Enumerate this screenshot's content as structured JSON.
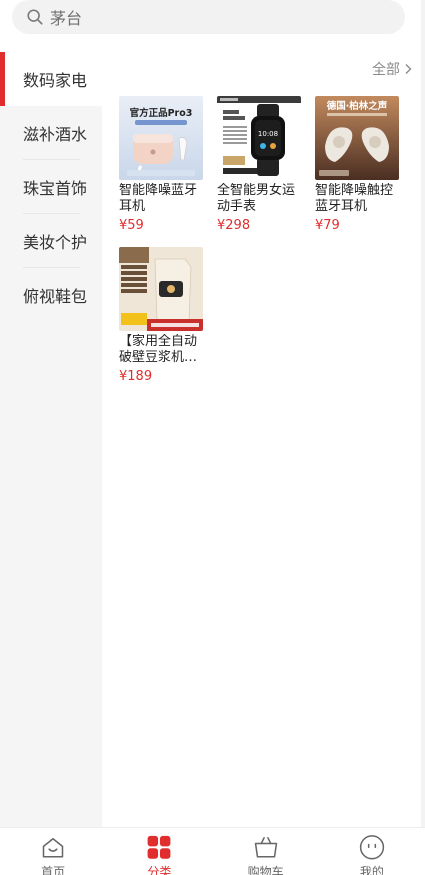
{
  "search": {
    "placeholder": "茅台"
  },
  "sidebar": {
    "items": [
      {
        "label": "数码家电",
        "active": true
      },
      {
        "label": "滋补酒水",
        "active": false
      },
      {
        "label": "珠宝首饰",
        "active": false
      },
      {
        "label": "美妆个护",
        "active": false
      },
      {
        "label": "俯视鞋包",
        "active": false
      }
    ]
  },
  "main": {
    "all_label": "全部",
    "products": [
      {
        "name": "智能降噪蓝牙耳机",
        "price": "¥59",
        "image_text": "官方正品Pro3"
      },
      {
        "name": "全智能男女运动手表",
        "price": "¥298",
        "image_text": ""
      },
      {
        "name": "智能降噪触控蓝牙耳机",
        "price": "¥79",
        "image_text": "德国·柏林之声"
      },
      {
        "name": "【家用全自动破壁豆浆机…",
        "price": "¥189",
        "image_text": ""
      }
    ]
  },
  "tabbar": {
    "items": [
      {
        "label": "首页",
        "icon": "home-icon"
      },
      {
        "label": "分类",
        "icon": "category-icon"
      },
      {
        "label": "购物车",
        "icon": "cart-icon"
      },
      {
        "label": "我的",
        "icon": "profile-icon"
      }
    ]
  },
  "colors": {
    "accent": "#e02e2e",
    "sidebar_bg": "#f5f5f5",
    "search_bg": "#f2f2f2"
  }
}
